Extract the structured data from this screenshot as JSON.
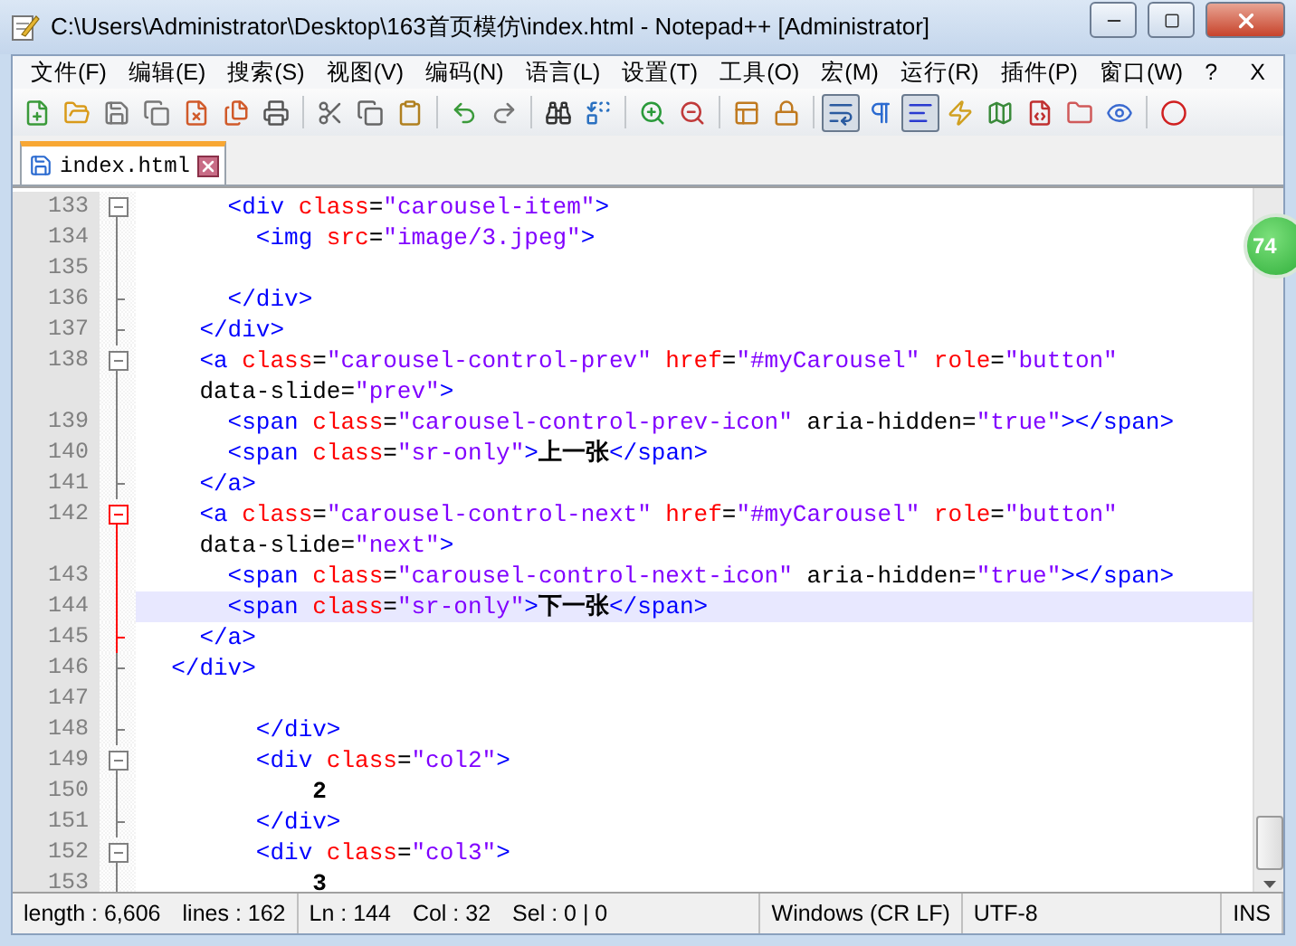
{
  "window": {
    "title": "C:\\Users\\Administrator\\Desktop\\163首页模仿\\index.html - Notepad++ [Administrator]"
  },
  "menu": [
    "文件(F)",
    "编辑(E)",
    "搜索(S)",
    "视图(V)",
    "编码(N)",
    "语言(L)",
    "设置(T)",
    "工具(O)",
    "宏(M)",
    "运行(R)",
    "插件(P)",
    "窗口(W)",
    "?"
  ],
  "menu_close": "X",
  "toolbar": [
    {
      "pressed": false
    },
    {
      "pressed": false
    },
    {
      "pressed": false
    },
    {
      "pressed": false
    },
    {
      "pressed": false
    },
    {
      "pressed": false
    },
    {
      "pressed": false
    },
    {
      "pressed": false
    },
    {
      "pressed": false
    },
    {
      "pressed": false
    },
    {
      "pressed": false
    },
    {
      "pressed": false
    },
    {
      "pressed": false
    },
    {
      "pressed": false
    },
    {
      "pressed": false
    },
    {
      "pressed": false
    },
    {
      "pressed": false
    },
    {
      "pressed": false
    },
    {
      "pressed": true
    },
    {
      "pressed": false
    },
    {
      "pressed": true
    },
    {
      "pressed": false
    },
    {
      "pressed": false
    },
    {
      "pressed": false
    },
    {
      "pressed": false
    },
    {
      "pressed": false
    },
    {
      "pressed": false
    }
  ],
  "tabs": [
    {
      "label": "index.html",
      "selected": true
    }
  ],
  "badge": "74",
  "lines": [
    {
      "number": "133",
      "kind": "fold-start",
      "active": false,
      "current": false,
      "tokens": [
        {
          "kind": "tag",
          "text": "      <div "
        },
        {
          "kind": "attribute",
          "text": "class"
        },
        {
          "kind": "plain",
          "text": "="
        },
        {
          "kind": "string",
          "text": "\"carousel-item\""
        },
        {
          "kind": "tag",
          "text": ">"
        }
      ]
    },
    {
      "number": "134",
      "kind": "fold-body",
      "active": false,
      "current": false,
      "tokens": [
        {
          "kind": "tag",
          "text": "        <img "
        },
        {
          "kind": "attribute",
          "text": "src"
        },
        {
          "kind": "plain",
          "text": "="
        },
        {
          "kind": "string",
          "text": "\"image/3.jpeg\""
        },
        {
          "kind": "tag",
          "text": ">"
        }
      ]
    },
    {
      "number": "135",
      "kind": "fold-body",
      "active": false,
      "current": false
    },
    {
      "number": "136",
      "kind": "fold-end",
      "active": false,
      "current": false,
      "tokens": [
        {
          "kind": "tag",
          "text": "      </div>"
        }
      ]
    },
    {
      "number": "137",
      "kind": "fold-end",
      "active": false,
      "current": false,
      "tokens": [
        {
          "kind": "tag",
          "text": "    </div>"
        }
      ]
    },
    {
      "number": "138",
      "kind": "fold-start",
      "active": false,
      "current": false,
      "tokens": [
        {
          "kind": "tag",
          "text": "    <a "
        },
        {
          "kind": "attribute",
          "text": "class"
        },
        {
          "kind": "plain",
          "text": "="
        },
        {
          "kind": "string",
          "text": "\"carousel-control-prev\""
        },
        {
          "kind": "attribute",
          "text": " href"
        },
        {
          "kind": "plain",
          "text": "="
        },
        {
          "kind": "string",
          "text": "\"#myCarousel\""
        },
        {
          "kind": "attribute",
          "text": " role"
        },
        {
          "kind": "plain",
          "text": "="
        },
        {
          "kind": "string",
          "text": "\"button\""
        }
      ]
    },
    {
      "kind": "fold-body",
      "active": false,
      "current": false,
      "tokens": [
        {
          "kind": "plain",
          "text": "    data-slide="
        },
        {
          "kind": "string",
          "text": "\"prev\""
        },
        {
          "kind": "tag",
          "text": ">"
        }
      ]
    },
    {
      "number": "139",
      "kind": "fold-body",
      "active": false,
      "current": false,
      "tokens": [
        {
          "kind": "tag",
          "text": "      <span "
        },
        {
          "kind": "attribute",
          "text": "class"
        },
        {
          "kind": "plain",
          "text": "="
        },
        {
          "kind": "string",
          "text": "\"carousel-control-prev-icon\""
        },
        {
          "kind": "plain",
          "text": " aria-hidden="
        },
        {
          "kind": "string",
          "text": "\"true\""
        },
        {
          "kind": "tag",
          "text": "></span>"
        }
      ]
    },
    {
      "number": "140",
      "kind": "fold-body",
      "active": false,
      "current": false,
      "tokens": [
        {
          "kind": "tag",
          "text": "      <span "
        },
        {
          "kind": "attribute",
          "text": "class"
        },
        {
          "kind": "plain",
          "text": "="
        },
        {
          "kind": "string",
          "text": "\"sr-only\""
        },
        {
          "kind": "tag",
          "text": ">"
        },
        {
          "kind": "content",
          "text": "上一张"
        },
        {
          "kind": "tag",
          "text": "</span>"
        }
      ]
    },
    {
      "number": "141",
      "kind": "fold-end",
      "active": false,
      "current": false,
      "tokens": [
        {
          "kind": "tag",
          "text": "    </a>"
        }
      ]
    },
    {
      "number": "142",
      "kind": "fold-start",
      "active": true,
      "current": false,
      "tokens": [
        {
          "kind": "tag",
          "text": "    <a "
        },
        {
          "kind": "attribute",
          "text": "class"
        },
        {
          "kind": "plain",
          "text": "="
        },
        {
          "kind": "string",
          "text": "\"carousel-control-next\""
        },
        {
          "kind": "attribute",
          "text": " href"
        },
        {
          "kind": "plain",
          "text": "="
        },
        {
          "kind": "string",
          "text": "\"#myCarousel\""
        },
        {
          "kind": "attribute",
          "text": " role"
        },
        {
          "kind": "plain",
          "text": "="
        },
        {
          "kind": "string",
          "text": "\"button\""
        }
      ]
    },
    {
      "kind": "fold-body",
      "active": true,
      "current": false,
      "tokens": [
        {
          "kind": "plain",
          "text": "    data-slide="
        },
        {
          "kind": "string",
          "text": "\"next\""
        },
        {
          "kind": "tag",
          "text": ">"
        }
      ]
    },
    {
      "number": "143",
      "kind": "fold-body",
      "active": true,
      "current": false,
      "tokens": [
        {
          "kind": "tag",
          "text": "      <span "
        },
        {
          "kind": "attribute",
          "text": "class"
        },
        {
          "kind": "plain",
          "text": "="
        },
        {
          "kind": "string",
          "text": "\"carousel-control-next-icon\""
        },
        {
          "kind": "plain",
          "text": " aria-hidden="
        },
        {
          "kind": "string",
          "text": "\"true\""
        },
        {
          "kind": "tag",
          "text": "></span>"
        }
      ]
    },
    {
      "number": "144",
      "kind": "fold-body",
      "active": true,
      "current": true,
      "tokens": [
        {
          "kind": "tag",
          "text": "      <span "
        },
        {
          "kind": "attribute",
          "text": "class"
        },
        {
          "kind": "plain",
          "text": "="
        },
        {
          "kind": "string",
          "text": "\"sr-only\""
        },
        {
          "kind": "tag",
          "text": ">"
        },
        {
          "kind": "content",
          "text": "下一张"
        },
        {
          "kind": "tag",
          "text": "</span>"
        }
      ]
    },
    {
      "number": "145",
      "kind": "fold-end",
      "active": true,
      "current": false,
      "tokens": [
        {
          "kind": "tag",
          "text": "    </a>"
        }
      ]
    },
    {
      "number": "146",
      "kind": "fold-end",
      "active": false,
      "current": false,
      "tokens": [
        {
          "kind": "tag",
          "text": "  </div>"
        }
      ]
    },
    {
      "number": "147",
      "kind": "fold-body",
      "active": false,
      "current": false
    },
    {
      "number": "148",
      "kind": "fold-end",
      "active": false,
      "current": false,
      "tokens": [
        {
          "kind": "tag",
          "text": "        </div>"
        }
      ]
    },
    {
      "number": "149",
      "kind": "fold-start",
      "active": false,
      "current": false,
      "tokens": [
        {
          "kind": "tag",
          "text": "        <div "
        },
        {
          "kind": "attribute",
          "text": "class"
        },
        {
          "kind": "plain",
          "text": "="
        },
        {
          "kind": "string",
          "text": "\"col2\""
        },
        {
          "kind": "tag",
          "text": ">"
        }
      ]
    },
    {
      "number": "150",
      "kind": "fold-body",
      "active": false,
      "current": false,
      "tokens": [
        {
          "kind": "content",
          "text": "            2"
        }
      ]
    },
    {
      "number": "151",
      "kind": "fold-end",
      "active": false,
      "current": false,
      "tokens": [
        {
          "kind": "tag",
          "text": "        </div>"
        }
      ]
    },
    {
      "number": "152",
      "kind": "fold-start",
      "active": false,
      "current": false,
      "tokens": [
        {
          "kind": "tag",
          "text": "        <div "
        },
        {
          "kind": "attribute",
          "text": "class"
        },
        {
          "kind": "plain",
          "text": "="
        },
        {
          "kind": "string",
          "text": "\"col3\""
        },
        {
          "kind": "tag",
          "text": ">"
        }
      ]
    },
    {
      "number": "153",
      "kind": "fold-body",
      "active": false,
      "current": false,
      "tokens": [
        {
          "kind": "content",
          "text": "            3"
        }
      ]
    }
  ],
  "status_bar": [
    {
      "text": "length : 6,606",
      "kind": "group"
    },
    {
      "text": "lines : 162",
      "kind": "end"
    },
    {
      "text": "Ln : 144",
      "kind": "group"
    },
    {
      "text": "Col : 32",
      "kind": "group"
    },
    {
      "text": "Sel : 0 | 0",
      "kind": "fill"
    },
    {
      "text": "Windows (CR LF)",
      "kind": "end"
    },
    {
      "text": "UTF-8",
      "kind": "fill"
    },
    {
      "text": "INS",
      "kind": "end"
    }
  ]
}
